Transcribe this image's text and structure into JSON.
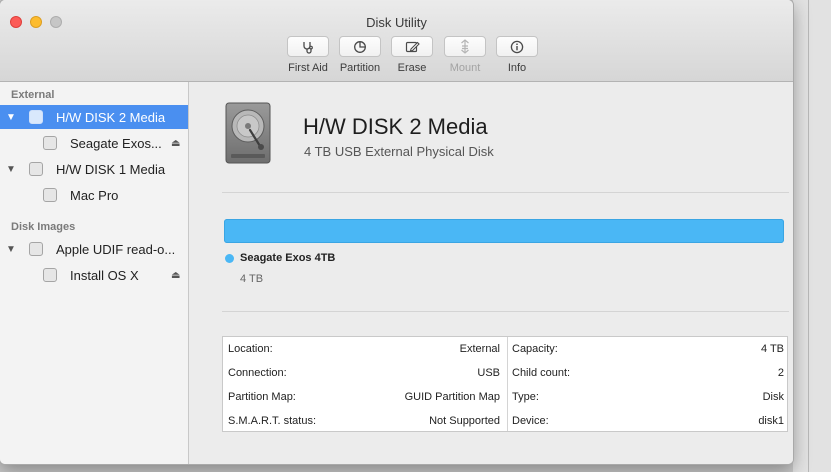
{
  "window": {
    "title": "Disk Utility"
  },
  "toolbar": {
    "buttons": [
      {
        "label": "First Aid",
        "icon": "stethoscope-icon",
        "enabled": true
      },
      {
        "label": "Partition",
        "icon": "pie-partition-icon",
        "enabled": true
      },
      {
        "label": "Erase",
        "icon": "erase-icon",
        "enabled": true
      },
      {
        "label": "Mount",
        "icon": "mount-icon",
        "enabled": false
      },
      {
        "label": "Info",
        "icon": "info-icon",
        "enabled": true
      }
    ]
  },
  "sidebar": {
    "sections": [
      {
        "header": "External",
        "items": [
          {
            "label": "H/W DISK 2 Media",
            "level": 0,
            "selected": true,
            "eject": false
          },
          {
            "label": "Seagate Exos...",
            "level": 1,
            "selected": false,
            "eject": true
          },
          {
            "label": "H/W DISK 1 Media",
            "level": 0,
            "selected": false,
            "eject": false
          },
          {
            "label": "Mac Pro",
            "level": 1,
            "selected": false,
            "eject": false
          }
        ]
      },
      {
        "header": "Disk Images",
        "items": [
          {
            "label": "Apple UDIF read-o...",
            "level": 0,
            "selected": false,
            "eject": false
          },
          {
            "label": "Install OS X",
            "level": 1,
            "selected": false,
            "eject": true
          }
        ]
      }
    ]
  },
  "detail": {
    "title": "H/W DISK 2 Media",
    "subtitle": "4 TB USB External Physical Disk",
    "usage": {
      "color": "#4ab7f5",
      "fraction": 1.0,
      "partition_name": "Seagate Exos 4TB",
      "partition_size": "4 TB"
    },
    "info": {
      "left": [
        {
          "key": "Location:",
          "value": "External"
        },
        {
          "key": "Connection:",
          "value": "USB"
        },
        {
          "key": "Partition Map:",
          "value": "GUID Partition Map"
        },
        {
          "key": "S.M.A.R.T. status:",
          "value": "Not Supported"
        }
      ],
      "right": [
        {
          "key": "Capacity:",
          "value": "4 TB"
        },
        {
          "key": "Child count:",
          "value": "2"
        },
        {
          "key": "Type:",
          "value": "Disk"
        },
        {
          "key": "Device:",
          "value": "disk1"
        }
      ]
    }
  },
  "colors": {
    "selection": "#4a8ff0",
    "accent": "#4ab7f5"
  }
}
